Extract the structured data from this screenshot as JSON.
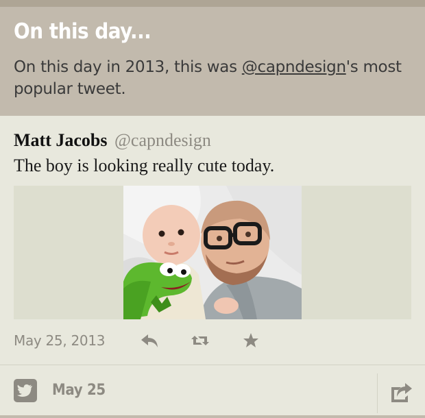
{
  "header": {
    "title": "On this day...",
    "desc_before": "On this day in 2013, this was ",
    "desc_link": "@capndesign",
    "desc_after": "'s most popular tweet."
  },
  "tweet": {
    "author_name": "Matt Jacobs",
    "author_handle": "@capndesign",
    "text": "The boy is looking really cute today.",
    "photo_icon": "photo-baby-kermit-and-man",
    "date": "May 25, 2013",
    "actions": [
      "reply-icon",
      "retweet-icon",
      "favorite-icon"
    ]
  },
  "footer": {
    "source_icon": "twitter-icon",
    "date": "May 25",
    "share_icon": "share-icon"
  },
  "colors": {
    "header_bg": "#c2baad",
    "card_bg": "#e8e8dd",
    "muted_text": "#8d8a82",
    "kermit_green": "#5db82e"
  }
}
